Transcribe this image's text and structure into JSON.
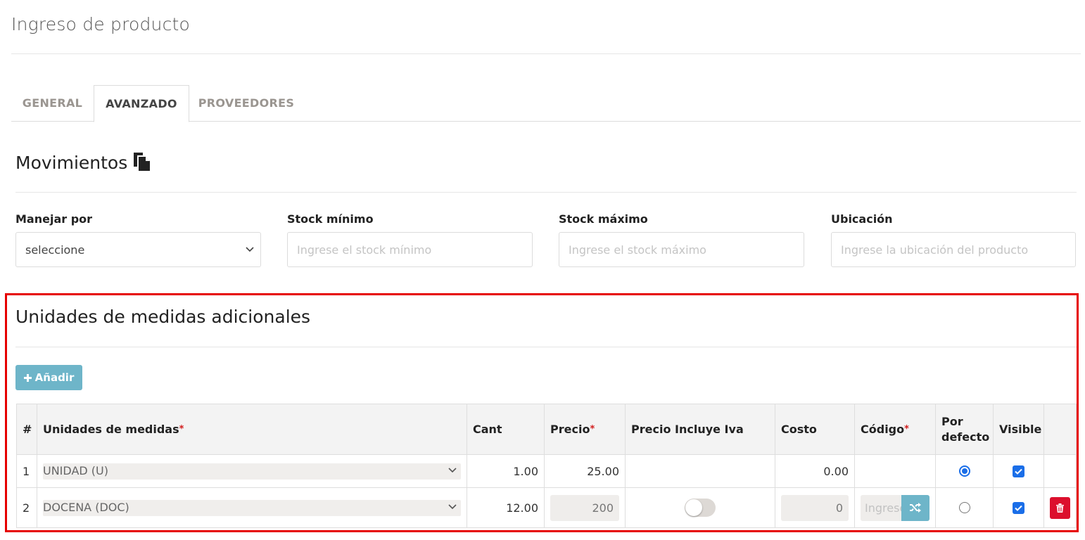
{
  "page": {
    "title": "Ingreso de producto"
  },
  "tabs": [
    {
      "label": "GENERAL",
      "active": false
    },
    {
      "label": "AVANZADO",
      "active": true
    },
    {
      "label": "PROVEEDORES",
      "active": false
    }
  ],
  "movimientos": {
    "title": "Movimientos",
    "icon": "copy-document-icon",
    "fields": {
      "manejar_por": {
        "label": "Manejar por",
        "value": "seleccione"
      },
      "stock_minimo": {
        "label": "Stock mínimo",
        "placeholder": "Ingrese el stock mínimo"
      },
      "stock_maximo": {
        "label": "Stock máximo",
        "placeholder": "Ingrese el stock máximo"
      },
      "ubicacion": {
        "label": "Ubicación",
        "placeholder": "Ingrese la ubicación del producto"
      }
    }
  },
  "unidades": {
    "title": "Unidades de medidas adicionales",
    "add_label": "Añadir",
    "columns": {
      "num": "#",
      "unidad": "Unidades de medidas",
      "cant": "Cant",
      "precio": "Precio",
      "iva": "Precio Incluye Iva",
      "costo": "Costo",
      "codigo": "Código",
      "defecto": "Por defecto",
      "visible": "Visible",
      "required_mark": "*"
    },
    "rows": [
      {
        "num": "1",
        "unidad": "UNIDAD (U)",
        "cant": "1.00",
        "precio": "25.00",
        "costo": "0.00",
        "por_defecto": true,
        "visible": true
      },
      {
        "num": "2",
        "unidad": "DOCENA (DOC)",
        "cant": "12.00",
        "precio": "200",
        "iva": false,
        "costo": "0",
        "codigo_placeholder": "Ingrese",
        "por_defecto": false,
        "visible": true
      }
    ]
  },
  "colors": {
    "accent": "#6eb5c9",
    "highlight_border": "#e60000",
    "danger": "#dc0f2d",
    "primary": "#1a6ee8"
  }
}
